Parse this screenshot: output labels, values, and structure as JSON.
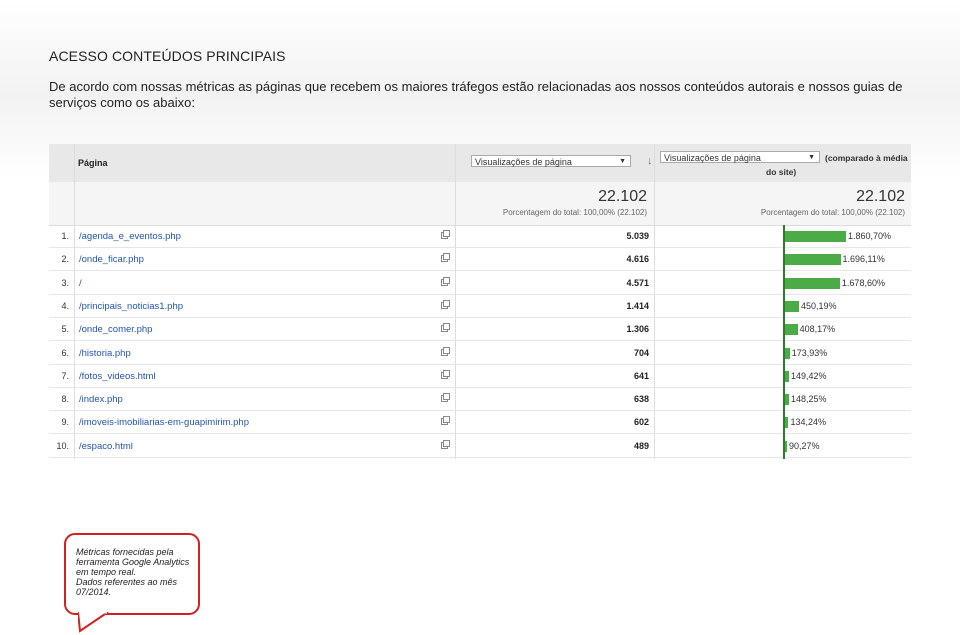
{
  "heading": "ACESSO CONTEÚDOS PRINCIPAIS",
  "intro": "De acordo com nossas métricas as páginas que recebem os maiores tráfegos estão relacionadas aos nossos conteúdos autorais e nossos guias de serviços como os abaixo:",
  "table": {
    "col_page": "Página",
    "metric_select": "Visualizações de página",
    "compare_select": "Visualizações de página",
    "compare_label_1": "(comparado à média",
    "compare_label_2": "do site)",
    "total_views": "22.102",
    "total_sub": "Porcentagem do total: 100,00% (22.102)",
    "total_views_2": "22.102",
    "total_sub_2": "Porcentagem do total: 100,00% (22.102)",
    "rows": [
      {
        "idx": "1.",
        "page": "/agenda_e_eventos.php",
        "views": "5.039",
        "pct": "1.860,70%",
        "pct_value": 1860.7
      },
      {
        "idx": "2.",
        "page": "/onde_ficar.php",
        "views": "4.616",
        "pct": "1.696,11%",
        "pct_value": 1696.11
      },
      {
        "idx": "3.",
        "page": "/",
        "views": "4.571",
        "pct": "1.678,60%",
        "pct_value": 1678.6
      },
      {
        "idx": "4.",
        "page": "/principais_noticias1.php",
        "views": "1.414",
        "pct": "450,19%",
        "pct_value": 450.19
      },
      {
        "idx": "5.",
        "page": "/onde_comer.php",
        "views": "1.306",
        "pct": "408,17%",
        "pct_value": 408.17
      },
      {
        "idx": "6.",
        "page": "/historia.php",
        "views": "704",
        "pct": "173,93%",
        "pct_value": 173.93
      },
      {
        "idx": "7.",
        "page": "/fotos_videos.html",
        "views": "641",
        "pct": "149,42%",
        "pct_value": 149.42
      },
      {
        "idx": "8.",
        "page": "/index.php",
        "views": "638",
        "pct": "148,25%",
        "pct_value": 148.25
      },
      {
        "idx": "9.",
        "page": "/imoveis-imobiliarias-em-guapimirim.php",
        "views": "602",
        "pct": "134,24%",
        "pct_value": 134.24
      },
      {
        "idx": "10.",
        "page": "/espaco.html",
        "views": "489",
        "pct": "90,27%",
        "pct_value": 90.27
      }
    ]
  },
  "note": {
    "lines": [
      "Métricas fornecidas pela",
      "ferramenta Google Analytics",
      "em tempo real.",
      "Dados referentes ao mês",
      "07/2014."
    ]
  },
  "colors": {
    "bar": "#4aab47",
    "link": "#2255aa",
    "note_border": "#d32020"
  }
}
